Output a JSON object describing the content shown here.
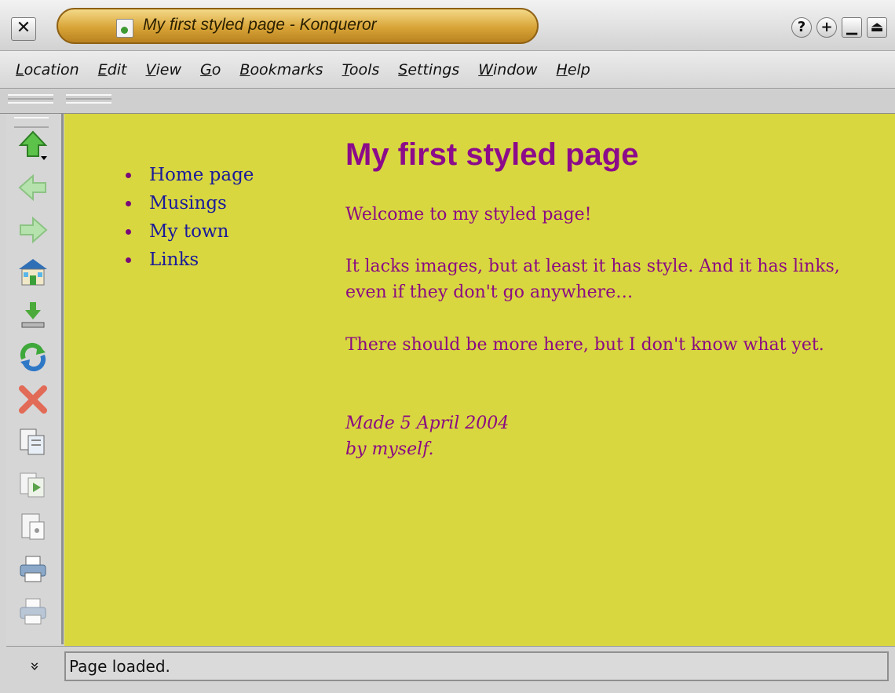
{
  "window": {
    "title": "My first styled page - Konqueror",
    "close_glyph": "✕",
    "buttons": [
      {
        "name": "help-icon",
        "glyph": "?"
      },
      {
        "name": "sticky-icon",
        "glyph": "+"
      },
      {
        "name": "minimize-icon",
        "glyph": "▁"
      },
      {
        "name": "maximize-icon",
        "glyph": "⏏"
      }
    ]
  },
  "menubar": {
    "items": [
      {
        "first": "L",
        "rest": "ocation"
      },
      {
        "first": "E",
        "rest": "dit"
      },
      {
        "first": "V",
        "rest": "iew"
      },
      {
        "first": "G",
        "rest": "o"
      },
      {
        "first": "B",
        "rest": "ookmarks"
      },
      {
        "first": "T",
        "rest": "ools"
      },
      {
        "first": "S",
        "rest": "ettings"
      },
      {
        "first": "W",
        "rest": "indow"
      },
      {
        "first": "H",
        "rest": "elp"
      }
    ]
  },
  "sidebar": {
    "icons": [
      "up-icon",
      "back-icon",
      "forward-icon",
      "home-icon",
      "download-icon",
      "reload-icon",
      "stop-icon",
      "cut-icon",
      "copy-icon",
      "paste-icon",
      "print-icon",
      "print-frame-icon"
    ],
    "expand_glyph": "»"
  },
  "page": {
    "nav": [
      "Home page",
      "Musings",
      "My town",
      "Links"
    ],
    "heading": "My first styled page",
    "p1": "Welcome to my styled page!",
    "p2": "It lacks images, but at least it has style. And it has links, even if they don't go anywhere…",
    "p3": "There should be more here, but I don't know what yet.",
    "signature_line1": "Made 5 April 2004",
    "signature_line2": "by myself."
  },
  "status": {
    "text": "Page loaded."
  },
  "colors": {
    "page_background": "#d8d73f",
    "heading": "#8c0b8a",
    "text": "#8a0b82",
    "links": "#1a1a9a"
  }
}
